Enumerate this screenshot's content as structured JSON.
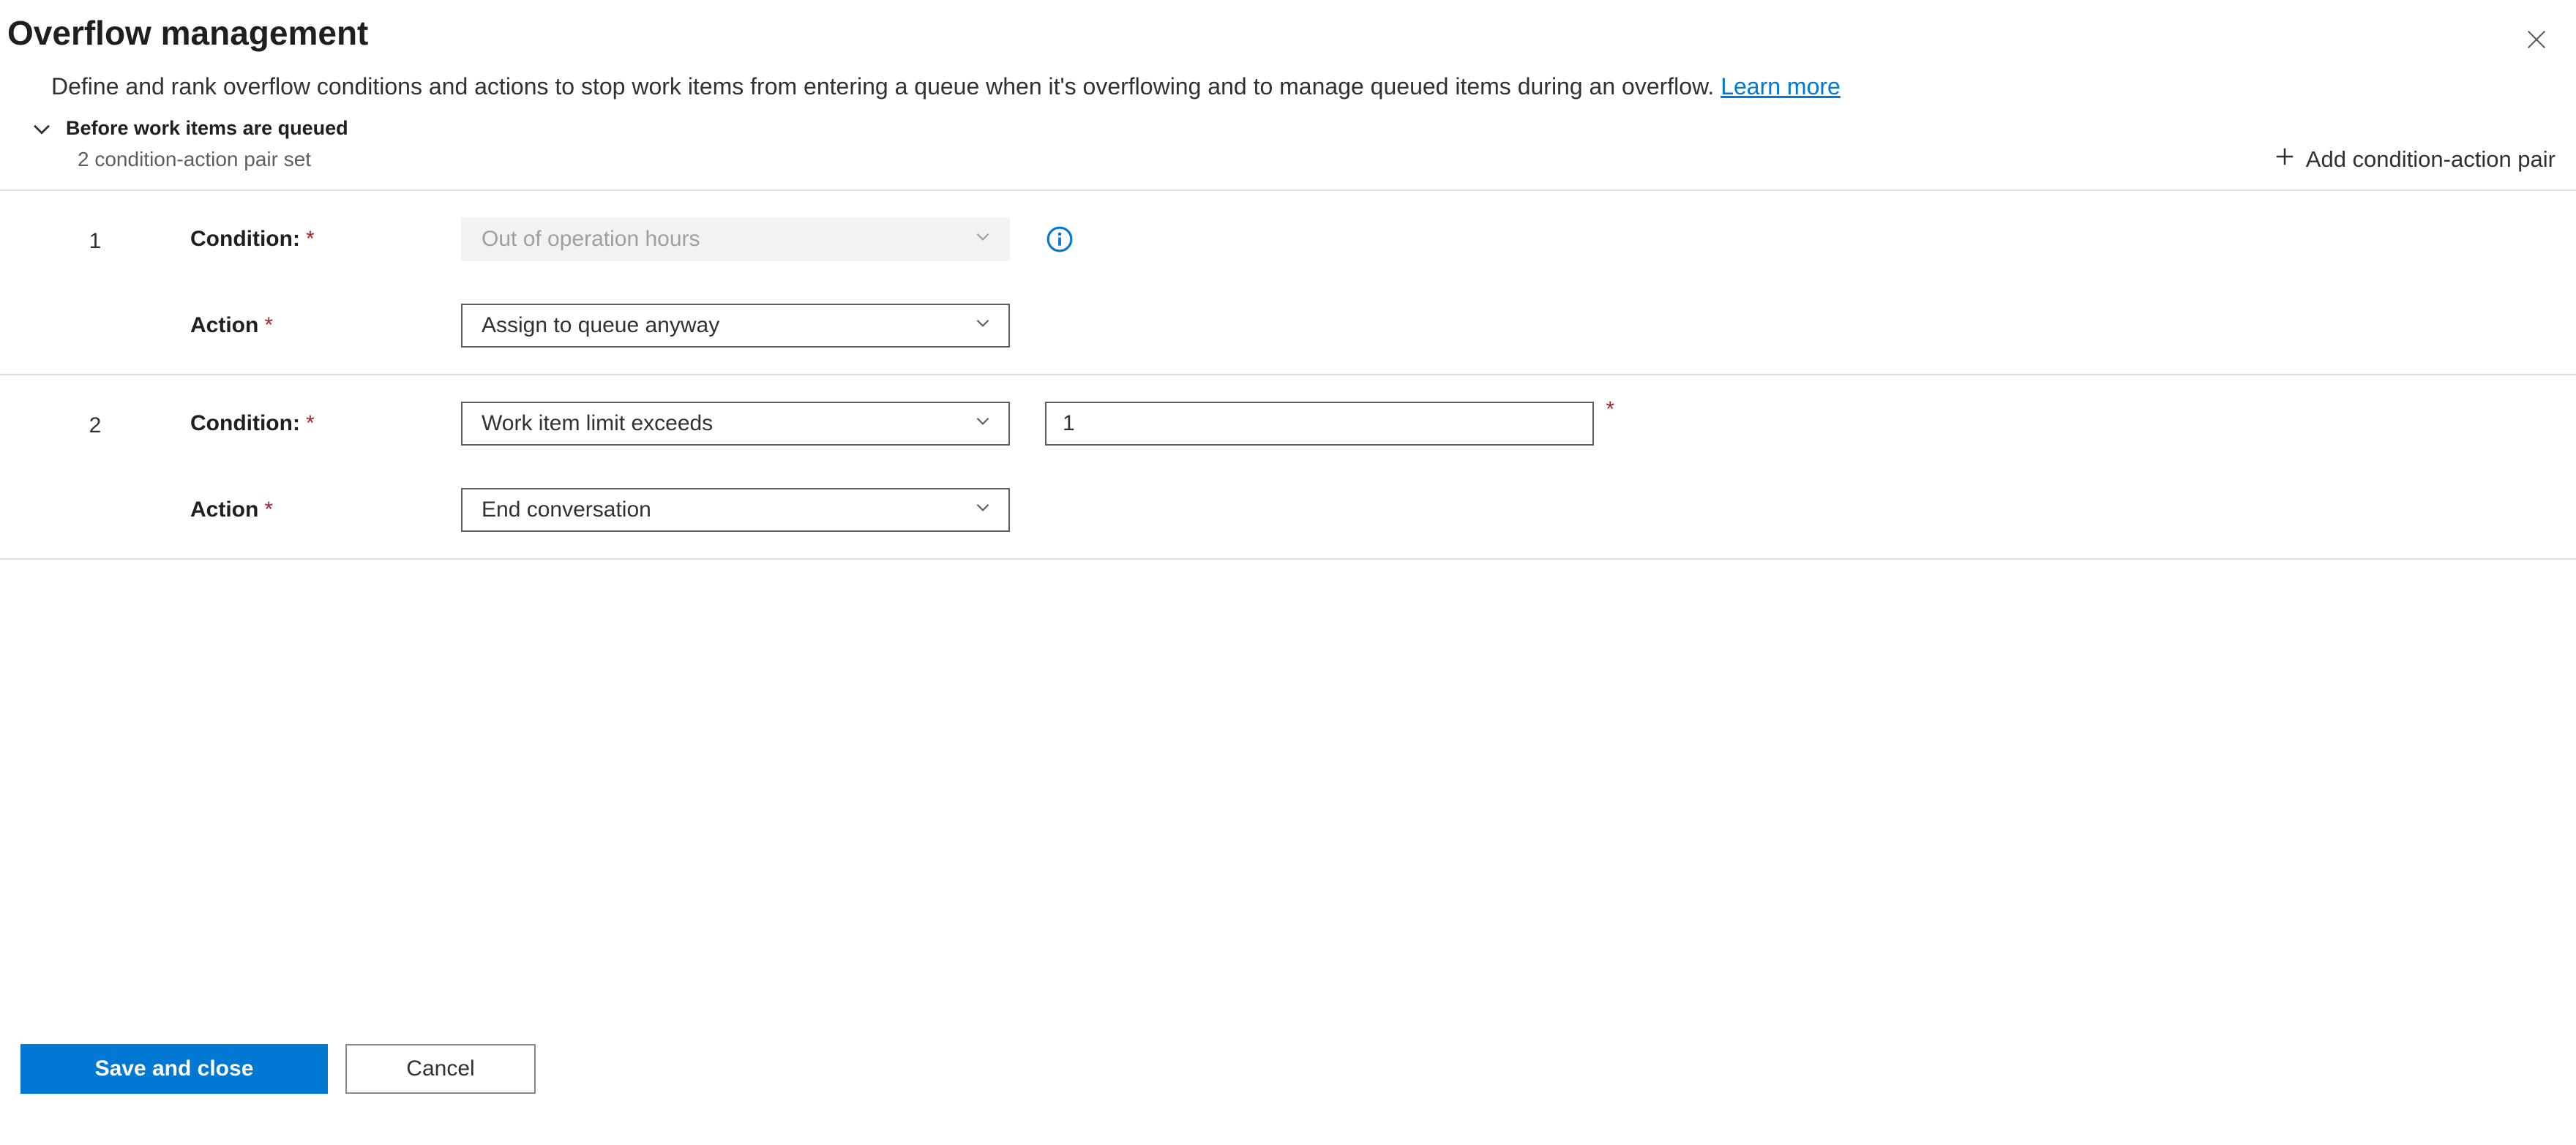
{
  "header": {
    "title": "Overflow management"
  },
  "description": {
    "text": "Define and rank overflow conditions and actions to stop work items from entering a queue when it's overflowing and to manage queued items during an overflow. ",
    "learn_more": "Learn more"
  },
  "section": {
    "title": "Before work items are queued",
    "subtitle": "2 condition-action pair set",
    "add_pair_label": "Add condition-action pair"
  },
  "labels": {
    "condition": "Condition:",
    "action": "Action"
  },
  "pairs": [
    {
      "index": "1",
      "condition_value": "Out of operation hours",
      "condition_disabled": true,
      "has_info_icon": true,
      "action_value": "Assign to queue anyway",
      "extra_input_value": null
    },
    {
      "index": "2",
      "condition_value": "Work item limit exceeds",
      "condition_disabled": false,
      "has_info_icon": false,
      "action_value": "End conversation",
      "extra_input_value": "1"
    }
  ],
  "footer": {
    "save_label": "Save and close",
    "cancel_label": "Cancel"
  }
}
